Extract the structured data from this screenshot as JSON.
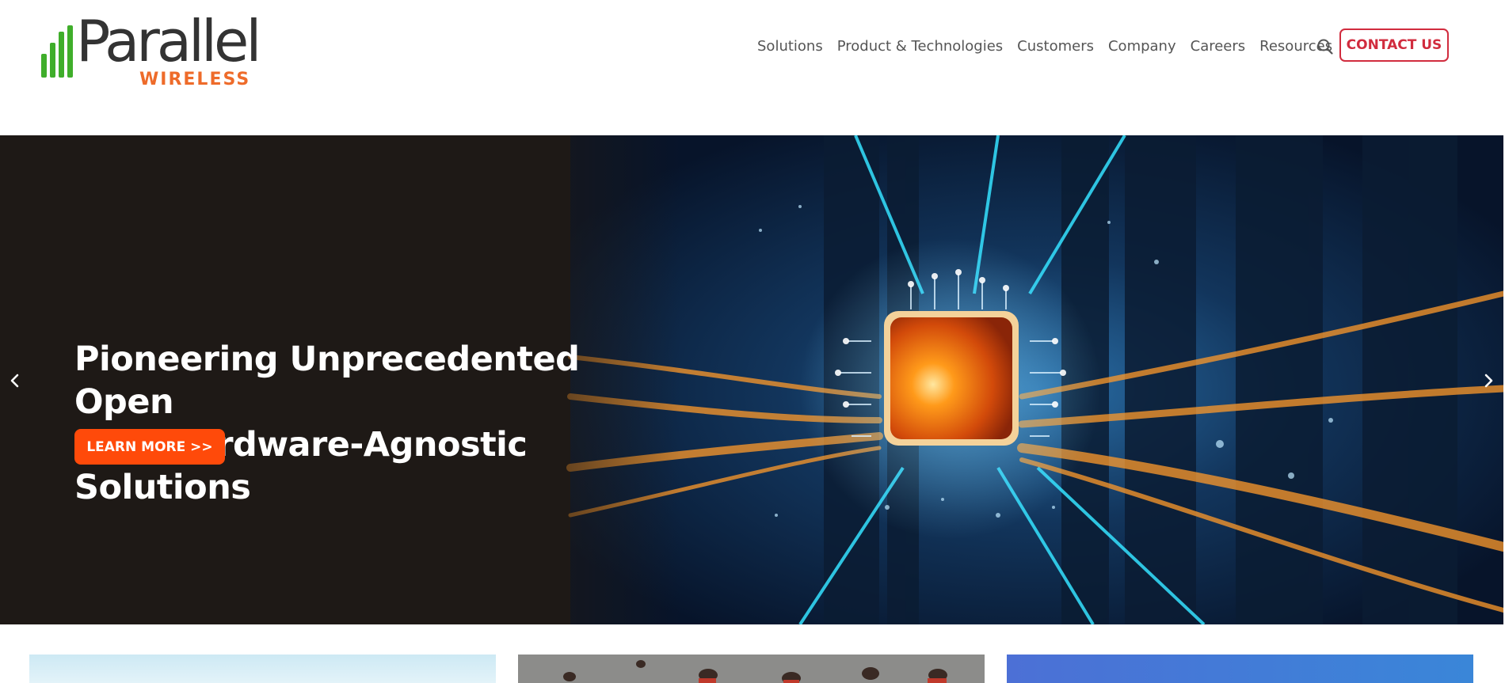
{
  "brand": {
    "name": "Parallel",
    "tagline": "WIRELESS",
    "green": "#3fae2a",
    "orange": "#ee6b2a",
    "gray": "#333333"
  },
  "nav": {
    "items": [
      {
        "label": "Solutions"
      },
      {
        "label": "Product & Technologies"
      },
      {
        "label": "Customers"
      },
      {
        "label": "Company"
      },
      {
        "label": "Careers"
      },
      {
        "label": "Resources"
      }
    ],
    "search_icon": "search-icon",
    "contact_label": "CONTACT US",
    "contact_color": "#d12c3e"
  },
  "hero": {
    "title_line1": "Pioneering Unprecedented Open",
    "title_line2": "RAN Hardware-Agnostic Solutions",
    "cta_label": "LEARN MORE >>",
    "cta_color": "#ff4a0a",
    "prev_icon": "chevron-left-icon",
    "next_icon": "chevron-right-icon"
  }
}
